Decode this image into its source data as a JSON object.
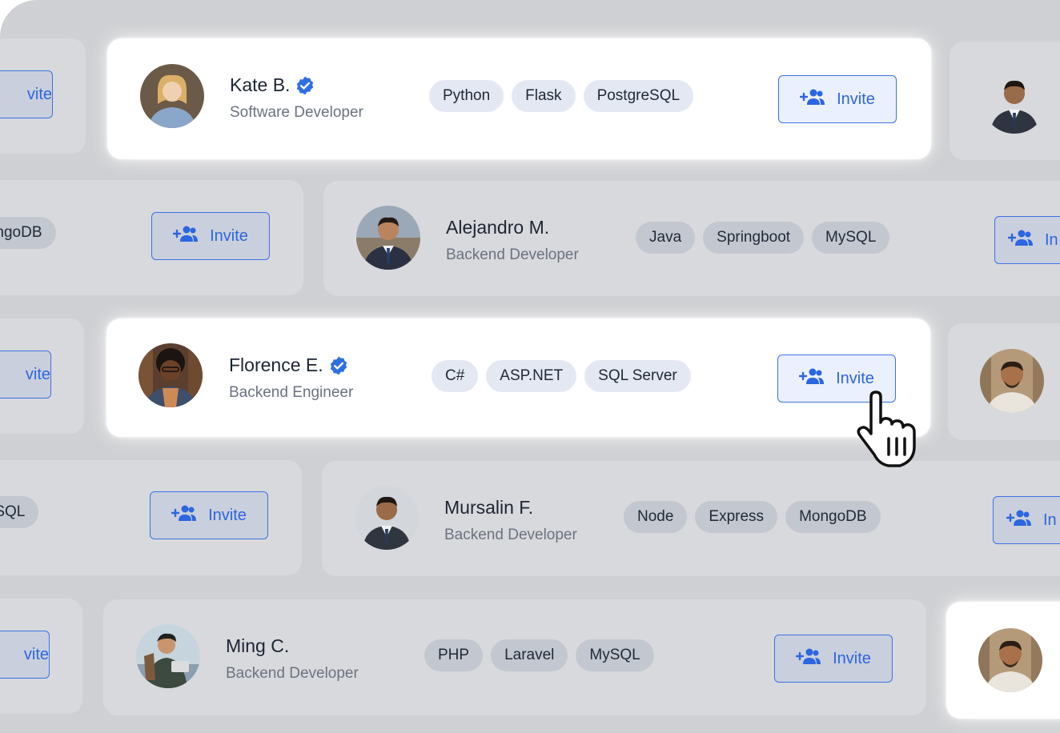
{
  "invite_label": "Invite",
  "colors": {
    "accent": "#2c66e0",
    "verified": "#2f6fe4"
  },
  "icons": {
    "invite": "add-user-group-icon",
    "verified": "verified-badge-icon",
    "cursor": "hand-pointer-icon"
  },
  "candidates": [
    {
      "name": "Kate B.",
      "verified": true,
      "role": "Software Developer",
      "skills": [
        "Python",
        "Flask",
        "PostgreSQL"
      ]
    },
    {
      "name": "Alejandro M.",
      "verified": false,
      "role": "Backend Developer",
      "skills": [
        "Java",
        "Springboot",
        "MySQL"
      ]
    },
    {
      "name": "Florence E.",
      "verified": true,
      "role": "Backend Engineer",
      "skills": [
        "C#",
        "ASP.NET",
        "SQL Server"
      ]
    },
    {
      "name": "Mursalin F.",
      "verified": false,
      "role": "Backend Developer",
      "skills": [
        "Node",
        "Express",
        "MongoDB"
      ]
    },
    {
      "name": "Ming C.",
      "verified": false,
      "role": "Backend Developer",
      "skills": [
        "PHP",
        "Laravel",
        "MySQL"
      ]
    }
  ],
  "partial_chips": {
    "row2": "MongoDB",
    "row4": "MySQL"
  },
  "partial_invite": {
    "left": "vite",
    "right": "In"
  }
}
